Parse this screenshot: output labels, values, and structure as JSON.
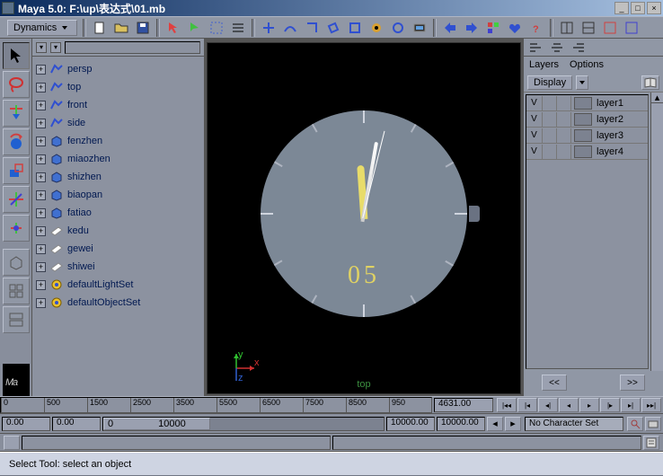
{
  "title": "Maya 5.0: F:\\up\\表达式\\01.mb",
  "menu_mode": "Dynamics",
  "outliner": {
    "items": [
      {
        "label": "persp",
        "type": "cam"
      },
      {
        "label": "top",
        "type": "cam"
      },
      {
        "label": "front",
        "type": "cam"
      },
      {
        "label": "side",
        "type": "cam"
      },
      {
        "label": "fenzhen",
        "type": "geo"
      },
      {
        "label": "miaozhen",
        "type": "geo"
      },
      {
        "label": "shizhen",
        "type": "geo"
      },
      {
        "label": "biaopan",
        "type": "geo"
      },
      {
        "label": "fatiao",
        "type": "geo"
      },
      {
        "label": "kedu",
        "type": "shape"
      },
      {
        "label": "gewei",
        "type": "shape"
      },
      {
        "label": "shiwei",
        "type": "shape"
      },
      {
        "label": "defaultLightSet",
        "type": "light"
      },
      {
        "label": "defaultObjectSet",
        "type": "light"
      }
    ]
  },
  "viewport": {
    "label": "top",
    "clock_number": "05"
  },
  "layers_panel": {
    "menu": {
      "layers": "Layers",
      "options": "Options"
    },
    "display": "Display",
    "layers": [
      {
        "v": "V",
        "name": "layer1"
      },
      {
        "v": "V",
        "name": "layer2"
      },
      {
        "v": "V",
        "name": "layer3"
      },
      {
        "v": "V",
        "name": "layer4"
      }
    ],
    "nav_prev": "<<",
    "nav_next": ">>"
  },
  "timeline": {
    "ticks": [
      "0",
      "500",
      "1500",
      "2500",
      "3500",
      "5500",
      "6500",
      "7500",
      "8500",
      "950"
    ],
    "current": "4631.00"
  },
  "range": {
    "start": "0.00",
    "in": "0.00",
    "slide_in": "0",
    "slide_out": "10000",
    "out": "10000.00",
    "end": "10000.00",
    "charset": "No Character Set"
  },
  "status": "Select Tool: select an object"
}
